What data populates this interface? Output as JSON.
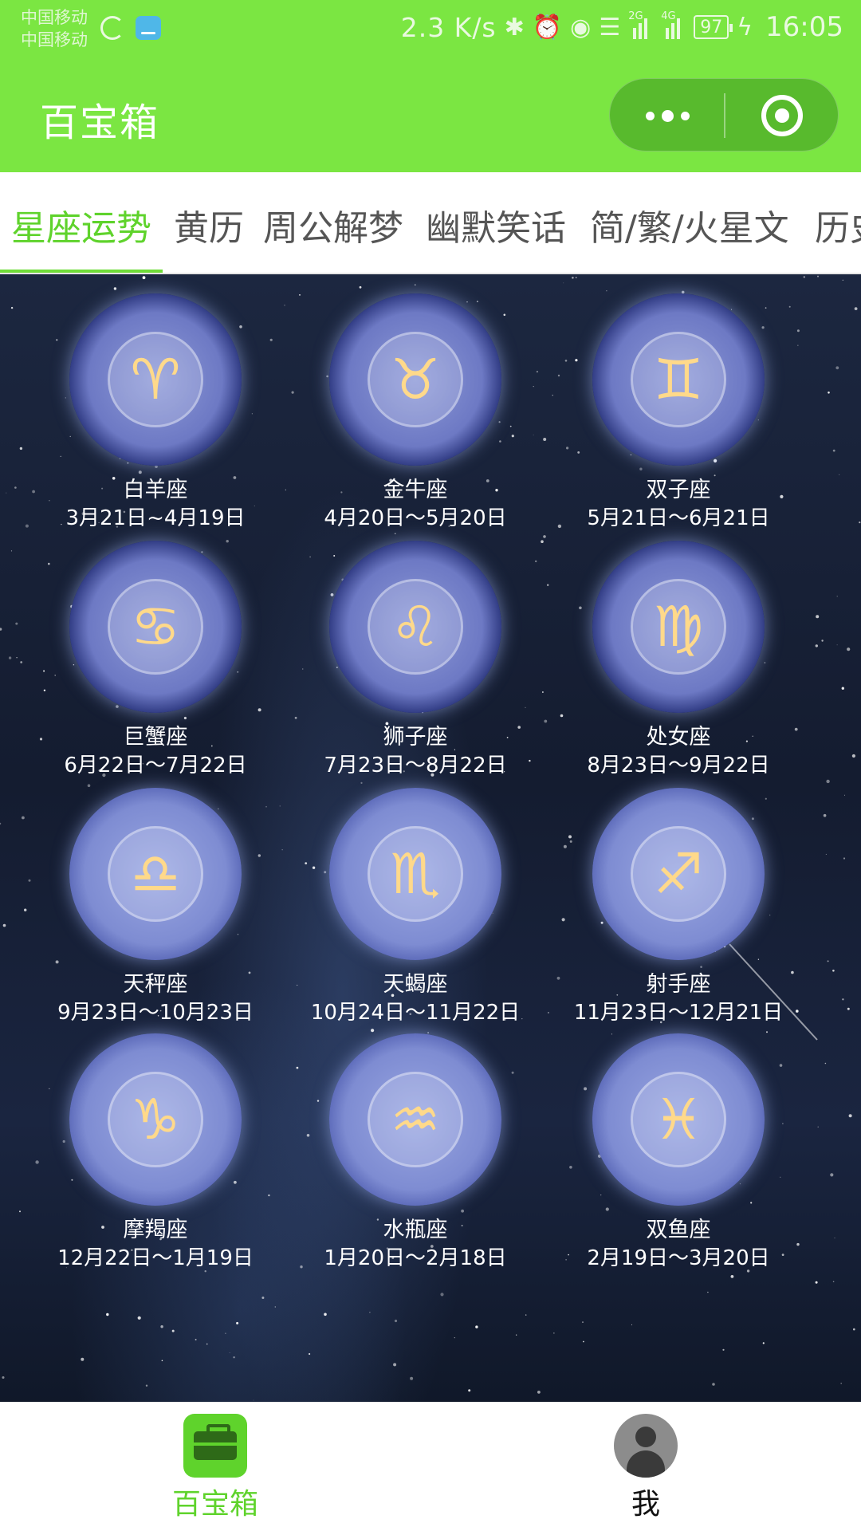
{
  "status_bar": {
    "carrier_1": "中国移动",
    "carrier_2": "中国移动",
    "speed": "2.3 K/s",
    "net_tag_1": "2G",
    "net_tag_2": "4G",
    "battery": "97",
    "time": "16:05"
  },
  "nav": {
    "title": "百宝箱"
  },
  "tabs": [
    {
      "label": "星座运势",
      "active": true
    },
    {
      "label": "黄历"
    },
    {
      "label": "周公解梦"
    },
    {
      "label": "幽默笑话"
    },
    {
      "label": "简/繁/火星文"
    },
    {
      "label": "历史"
    }
  ],
  "signs": [
    {
      "name": "白羊座",
      "date": "3月21日~4月19日",
      "symbol": "♈"
    },
    {
      "name": "金牛座",
      "date": "4月20日～5月20日",
      "symbol": "♉"
    },
    {
      "name": "双子座",
      "date": "5月21日～6月21日",
      "symbol": "♊"
    },
    {
      "name": "巨蟹座",
      "date": "6月22日～7月22日",
      "symbol": "♋"
    },
    {
      "name": "狮子座",
      "date": "7月23日～8月22日",
      "symbol": "♌"
    },
    {
      "name": "处女座",
      "date": "8月23日～9月22日",
      "symbol": "♍"
    },
    {
      "name": "天秤座",
      "date": "9月23日～10月23日",
      "symbol": "♎"
    },
    {
      "name": "天蝎座",
      "date": "10月24日～11月22日",
      "symbol": "♏"
    },
    {
      "name": "射手座",
      "date": "11月23日～12月21日",
      "symbol": "♐"
    },
    {
      "name": "摩羯座",
      "date": "12月22日～1月19日",
      "symbol": "♑"
    },
    {
      "name": "水瓶座",
      "date": "1月20日～2月18日",
      "symbol": "♒"
    },
    {
      "name": "双鱼座",
      "date": "2月19日～3月20日",
      "symbol": "♓"
    }
  ],
  "tabbar": {
    "home_label": "百宝箱",
    "me_label": "我"
  },
  "colors": {
    "accent": "#7be642",
    "active_tab": "#5fd32c"
  }
}
